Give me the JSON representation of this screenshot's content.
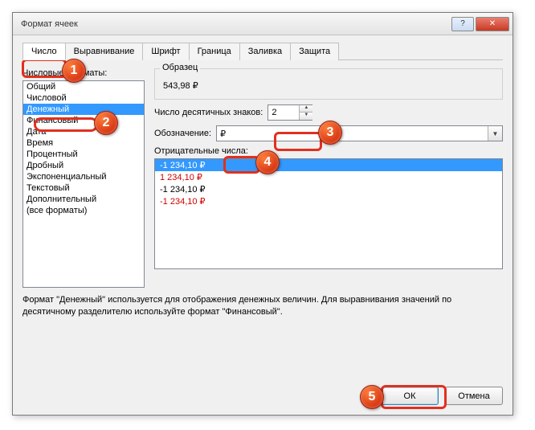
{
  "window": {
    "title": "Формат ячеек"
  },
  "tabs": {
    "number": "Число",
    "alignment": "Выравнивание",
    "font": "Шрифт",
    "border": "Граница",
    "fill": "Заливка",
    "protection": "Защита"
  },
  "labels": {
    "number_formats": "Числовые форматы:",
    "sample": "Образец",
    "decimals": "Число десятичных знаков:",
    "symbol": "Обозначение:",
    "negatives": "Отрицательные числа:"
  },
  "format_list": [
    "Общий",
    "Числовой",
    "Денежный",
    "Финансовый",
    "Дата",
    "Время",
    "Процентный",
    "Дробный",
    "Экспоненциальный",
    "Текстовый",
    "Дополнительный",
    "(все форматы)"
  ],
  "format_selected_index": 2,
  "sample_value": "543,98 ₽",
  "decimals_value": "2",
  "symbol_value": "₽",
  "negatives": [
    {
      "text": "-1 234,10 ₽",
      "style": "sel"
    },
    {
      "text": "1 234,10 ₽",
      "style": "red"
    },
    {
      "text": "-1 234,10 ₽",
      "style": ""
    },
    {
      "text": "-1 234,10 ₽",
      "style": "red"
    }
  ],
  "description": "Формат \"Денежный\" используется для отображения денежных величин. Для выравнивания значений по десятичному разделителю используйте формат \"Финансовый\".",
  "buttons": {
    "ok": "ОК",
    "cancel": "Отмена"
  },
  "badges": {
    "b1": "1",
    "b2": "2",
    "b3": "3",
    "b4": "4",
    "b5": "5"
  }
}
